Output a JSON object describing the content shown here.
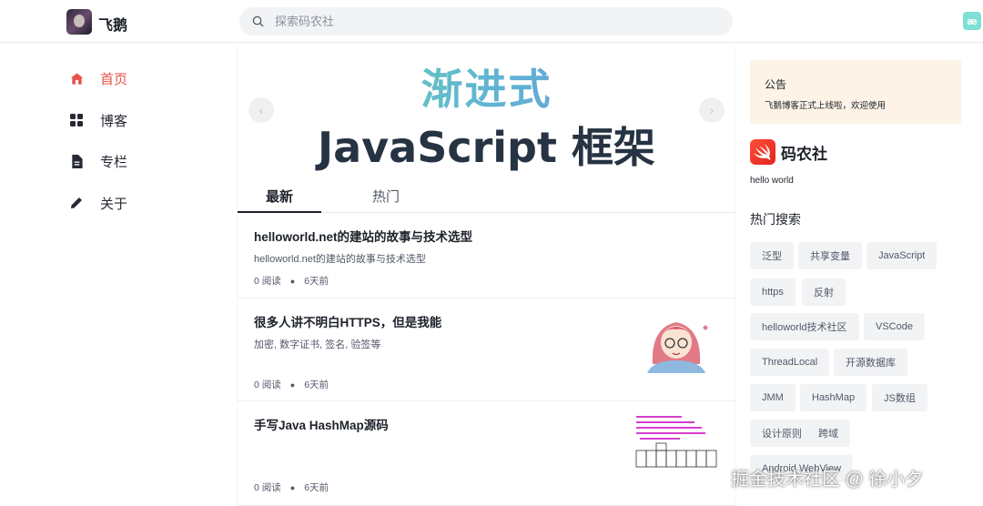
{
  "header": {
    "brand": "飞鹅",
    "search_placeholder": "探索码农社",
    "corner_badge": "æ"
  },
  "nav": {
    "items": [
      {
        "label": "首页",
        "icon": "home-icon",
        "active": true
      },
      {
        "label": "博客",
        "icon": "grid-icon",
        "active": false
      },
      {
        "label": "专栏",
        "icon": "file-icon",
        "active": false
      },
      {
        "label": "关于",
        "icon": "pen-icon",
        "active": false
      }
    ]
  },
  "banner": {
    "line1": "渐进式",
    "line2": "JavaScript 框架",
    "prev": "‹",
    "next": "›"
  },
  "tabs": {
    "latest": "最新",
    "hot": "热门"
  },
  "articles": [
    {
      "title": "helloworld.net的建站的故事与技术选型",
      "desc": "helloworld.net的建站的故事与技术选型",
      "reads": "0 阅读",
      "time": "6天前"
    },
    {
      "title": "很多人讲不明白HTTPS，但是我能",
      "desc": "加密, 数字证书, 签名, 验签等",
      "reads": "0 阅读",
      "time": "6天前"
    },
    {
      "title": "手写Java HashMap源码",
      "desc": "",
      "reads": "0 阅读",
      "time": "6天前"
    }
  ],
  "sidebar": {
    "notice_title": "公告",
    "notice_body": "飞鹅博客正式上线啦，欢迎使用",
    "site_name": "码农社",
    "slogan": "hello world",
    "hot_search_title": "热门搜索",
    "tags": [
      "泛型",
      "共享变量",
      "JavaScript",
      "https",
      "反射",
      "helloworld技术社区",
      "VSCode",
      "ThreadLocal",
      "开源数据库",
      "JMM",
      "HashMap",
      "JS数组",
      "设计原则",
      "跨域",
      "Android WebView"
    ]
  },
  "watermark": "掘金技术社区 @ 徐小夕",
  "colors": {
    "accent": "#e6524b",
    "notice_bg": "#fdf3e6",
    "logo_red": "#e0241d"
  }
}
